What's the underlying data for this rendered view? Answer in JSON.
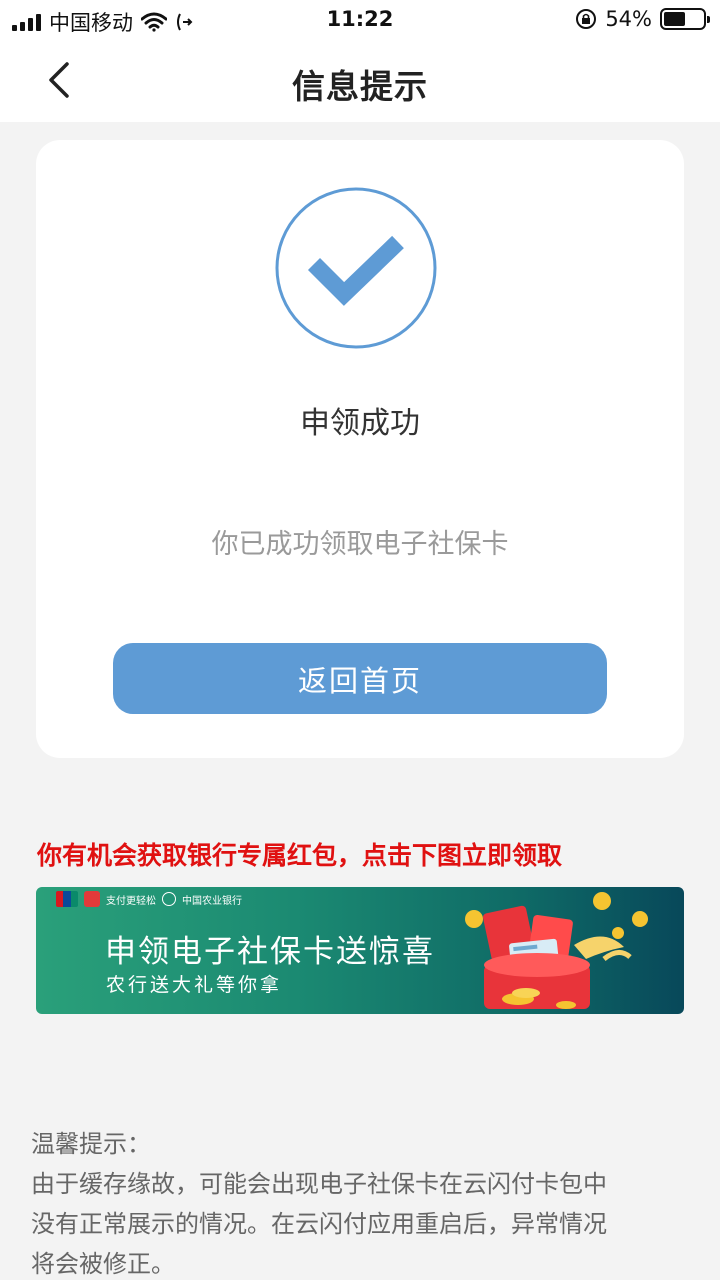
{
  "status_bar": {
    "carrier": "中国移动",
    "time": "11:22",
    "battery_percent_text": "54%",
    "battery_level": 0.54,
    "icons": [
      "signal-icon",
      "wifi-icon",
      "call-forward-icon",
      "orientation-lock-icon",
      "battery-icon"
    ]
  },
  "nav": {
    "title": "信息提示",
    "back_icon": "chevron-left-icon"
  },
  "card": {
    "icon": "checkmark-circle-icon",
    "title": "申领成功",
    "description": "你已成功领取电子社保卡",
    "button_label": "返回首页"
  },
  "promo": {
    "text": "你有机会获取银行专属红包，点击下图立即领取"
  },
  "banner": {
    "title": "申领电子社保卡送惊喜",
    "subtitle": "农行送大礼等你拿",
    "logo_text_1": "支付更轻松",
    "logo_text_2": "中国农业银行"
  },
  "tip": {
    "heading": "温馨提示：",
    "line1": "由于缓存缘故，可能会出现电子社保卡在云闪付卡包中",
    "line2": "没有正常展示的情况。在云闪付应用重启后，异常情况",
    "line3": "将会被修正。"
  },
  "colors": {
    "accent": "#5e9bd5",
    "promo_red": "#e01111",
    "background": "#f3f3f3"
  }
}
